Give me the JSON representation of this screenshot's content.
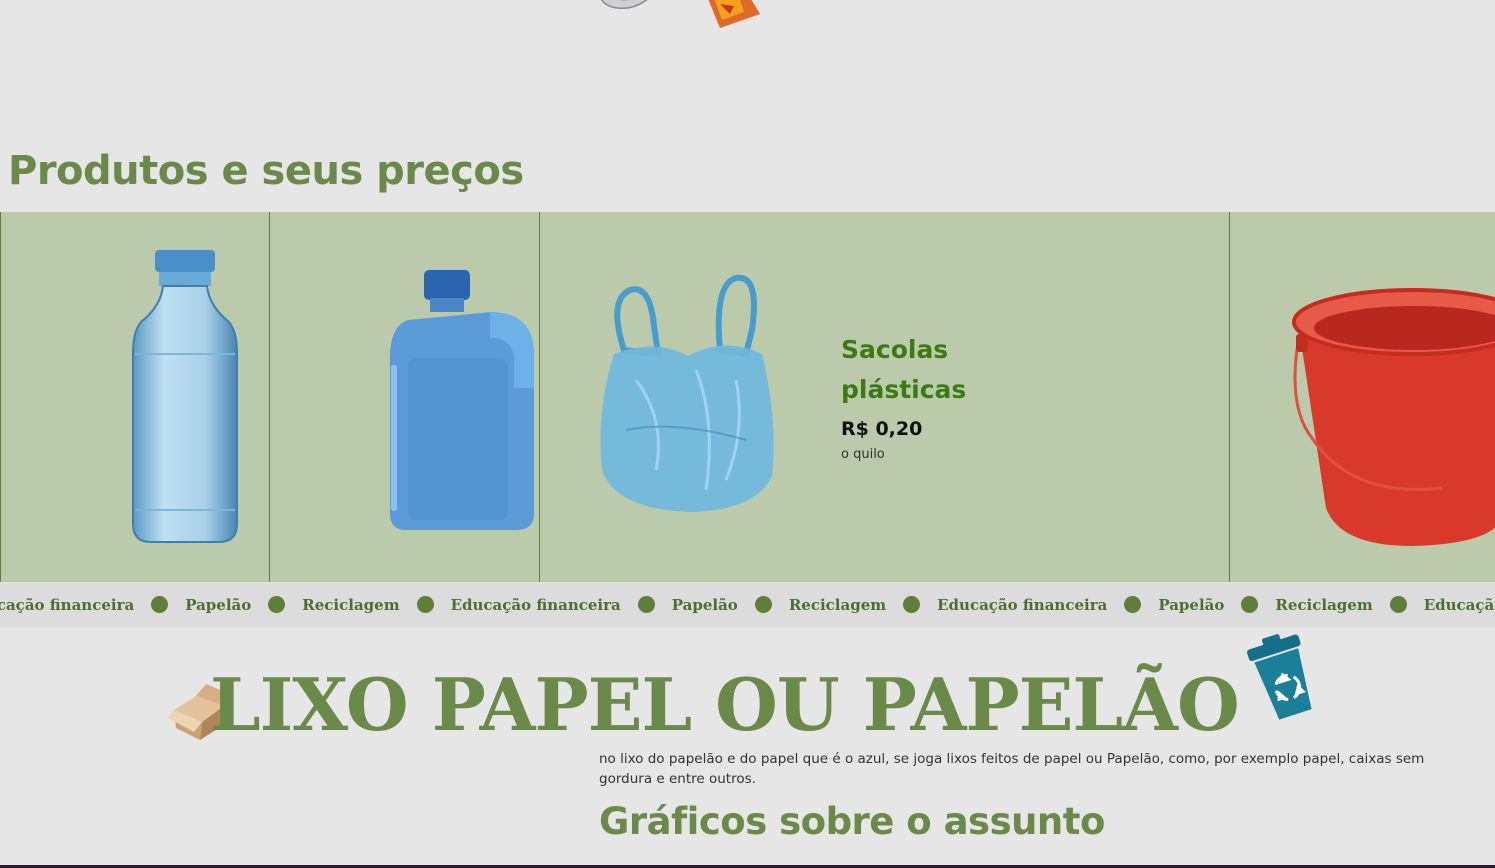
{
  "products_section": {
    "title": "Produtos e seus preços",
    "cards": [
      {
        "image_icon": "plastic-bottle-icon"
      },
      {
        "image_icon": "plastic-jug-icon"
      },
      {
        "image_icon": "plastic-bag-icon",
        "name": "Sacolas plásticas",
        "price": "R$ 0,20",
        "unit": "o quilo"
      },
      {
        "image_icon": "red-bucket-icon"
      }
    ]
  },
  "ticker": {
    "items": [
      "Educação financeira",
      "Papelão",
      "Reciclagem",
      "Educação financeira",
      "Papelão",
      "Reciclagem",
      "Educação financeira",
      "Papelão",
      "Reciclagem",
      "Educação financeira"
    ]
  },
  "paper_section": {
    "title": "LIXO PAPEL OU PAPELÃO",
    "description": "no lixo do papelão e do papel que é o azul, se joga lixos feitos de papel ou Papelão, como, por exemplo papel, caixas sem gordura e entre outros.",
    "charts_title": "Gráficos sobre o assunto"
  },
  "colors": {
    "accent_green": "#6a8a4a",
    "card_background": "#bccaac",
    "page_background": "#e6e6e6",
    "recycle_bin_blue": "#1b7f9a"
  }
}
